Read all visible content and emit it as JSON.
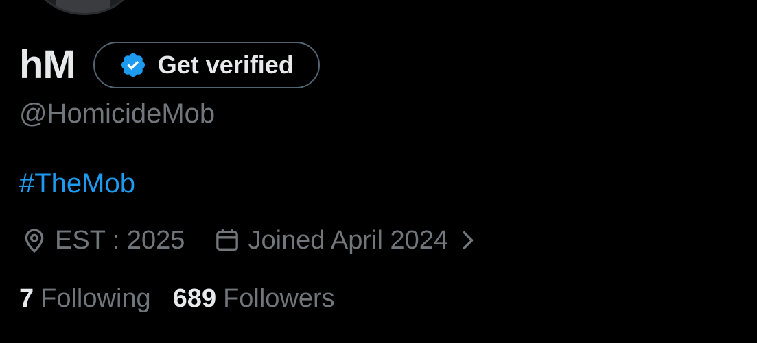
{
  "profile": {
    "display_name": "hM",
    "handle": "@HomicideMob",
    "bio": "#TheMob",
    "location": "EST : 2025",
    "joined": "Joined April 2024"
  },
  "verify_button": {
    "label": "Get verified",
    "icon": "verified-badge-icon",
    "color": "#1d9bf0"
  },
  "stats": {
    "following_count": "7",
    "following_label": "Following",
    "followers_count": "689",
    "followers_label": "Followers"
  },
  "icons": {
    "location": "location-pin-icon",
    "calendar": "calendar-icon",
    "chevron": "chevron-right-icon"
  },
  "colors": {
    "background": "#000000",
    "primary_text": "#e7e9ea",
    "secondary_text": "#71767b",
    "accent": "#1d9bf0",
    "border": "#536471"
  }
}
